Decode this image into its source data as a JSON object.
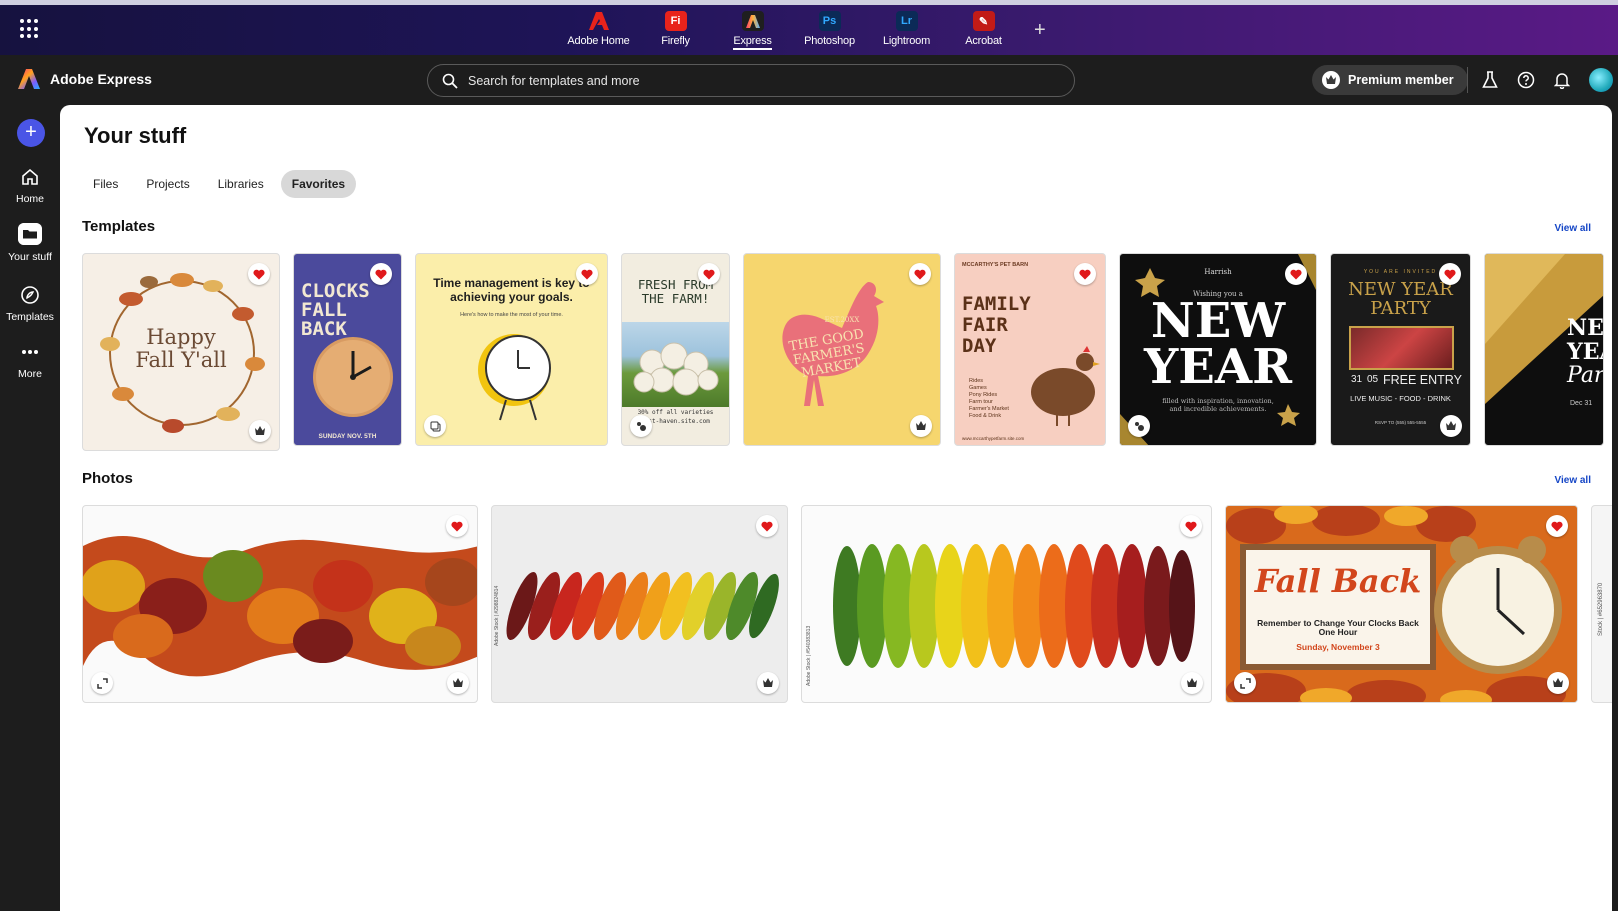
{
  "apps": [
    {
      "label": "Adobe Home",
      "logo": "A",
      "color": "#e8231b"
    },
    {
      "label": "Firefly",
      "logo": "Fi",
      "color": "#e8231b"
    },
    {
      "label": "Express",
      "logo": "A",
      "color": "#1f1f1f"
    },
    {
      "label": "Photoshop",
      "logo": "Ps",
      "color": "#0b2a57"
    },
    {
      "label": "Lightroom",
      "logo": "Lr",
      "color": "#0b2a57"
    },
    {
      "label": "Acrobat",
      "logo": "✎",
      "color": "#c21b17"
    }
  ],
  "active_app": "Express",
  "header": {
    "brand": "Adobe Express",
    "search_placeholder": "Search for templates and more",
    "premium": "Premium member"
  },
  "rail": [
    {
      "label": "Home"
    },
    {
      "label": "Your stuff"
    },
    {
      "label": "Templates"
    },
    {
      "label": "More"
    }
  ],
  "page": {
    "title": "Your stuff",
    "tabs": [
      "Files",
      "Projects",
      "Libraries",
      "Favorites"
    ],
    "active_tab": "Favorites"
  },
  "templates": {
    "title": "Templates",
    "view_all": "View all",
    "cards": [
      {
        "text": [
          "Happy",
          "Fall Y'all"
        ]
      },
      {
        "text": [
          "CLOCKS",
          "FALL",
          "BACK",
          "SUNDAY NOV. 5TH"
        ]
      },
      {
        "text": [
          "Time management is key to achieving your goals.",
          "Here's how to make the most of your time."
        ]
      },
      {
        "text": [
          "FRESH FROM THE FARM!",
          "30% off all varieties",
          "west-haven.site.com"
        ]
      },
      {
        "text": [
          "EST.20XX",
          "THE GOOD FARMER'S MARKET"
        ]
      },
      {
        "text": [
          "MCCARTHY'S PET BARN",
          "FAMILY",
          "FAIR",
          "DAY",
          "Rides",
          "Games",
          "Pony Rides",
          "Farm tour",
          "Farmer's Market",
          "Food & Drink",
          "www.mccarthypetfarm.site.com"
        ]
      },
      {
        "text": [
          "Harrish",
          "Wishing you a",
          "NEW",
          "YEAR",
          "filled with inspiration, innovation, and incredible achievements."
        ]
      },
      {
        "text": [
          "YOU ARE INVITED",
          "NEW YEAR PARTY",
          "31",
          "05",
          "FREE ENTRY",
          "LIVE MUSIC - FOOD - DRINK",
          "RSVP TO (555) 555-5555"
        ]
      },
      {
        "text": [
          "NE",
          "YEAR",
          "Party EV",
          "Dec 31"
        ]
      }
    ]
  },
  "photos": {
    "title": "Photos",
    "view_all": "View all",
    "cards": [
      {
        "text": []
      },
      {
        "text": [
          "Adobe Stock | #298824814"
        ]
      },
      {
        "text": [
          "Adobe Stock | #540383813"
        ]
      },
      {
        "text": [
          "Fall Back",
          "Remember to Change Your Clocks Back One Hour",
          "Sunday, November 3"
        ]
      },
      {
        "text": [
          "Stock | #652963870"
        ]
      }
    ]
  },
  "colors": {
    "accent": "#4a55e6",
    "link": "#1546c6",
    "heart": "#e0191b"
  }
}
